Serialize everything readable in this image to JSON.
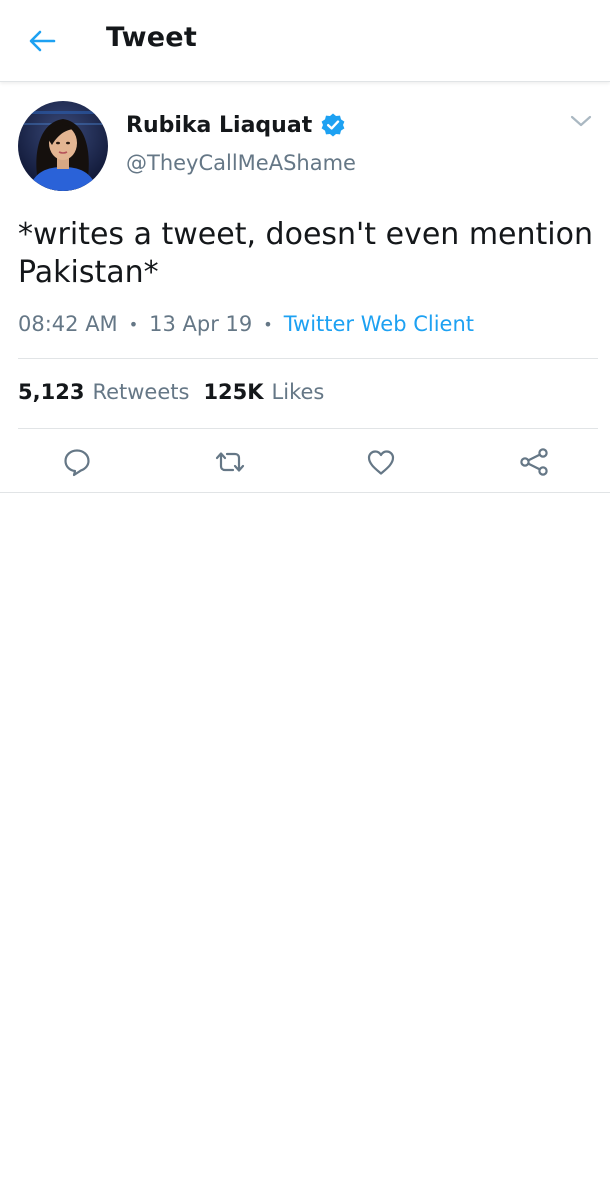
{
  "header": {
    "back_icon": "arrow-left-icon",
    "title": "Tweet"
  },
  "tweet": {
    "author": {
      "name": "Rubika Liaquat",
      "handle": "@TheyCallMeAShame",
      "verified": true,
      "avatar": "avatar-photo"
    },
    "text": "*writes a tweet, doesn't even mention Pakistan*",
    "time": "08:42 AM",
    "date": "13 Apr 19",
    "source": "Twitter Web Client",
    "stats": {
      "retweets_count": "5,123",
      "retweets_label": "Retweets",
      "likes_count": "125K",
      "likes_label": "Likes"
    },
    "actions": [
      "reply-icon",
      "retweet-icon",
      "like-icon",
      "share-icon"
    ]
  },
  "colors": {
    "accent": "#1da1f2",
    "text_primary": "#14171a",
    "text_secondary": "#657786",
    "divider": "#e1e4e6"
  }
}
